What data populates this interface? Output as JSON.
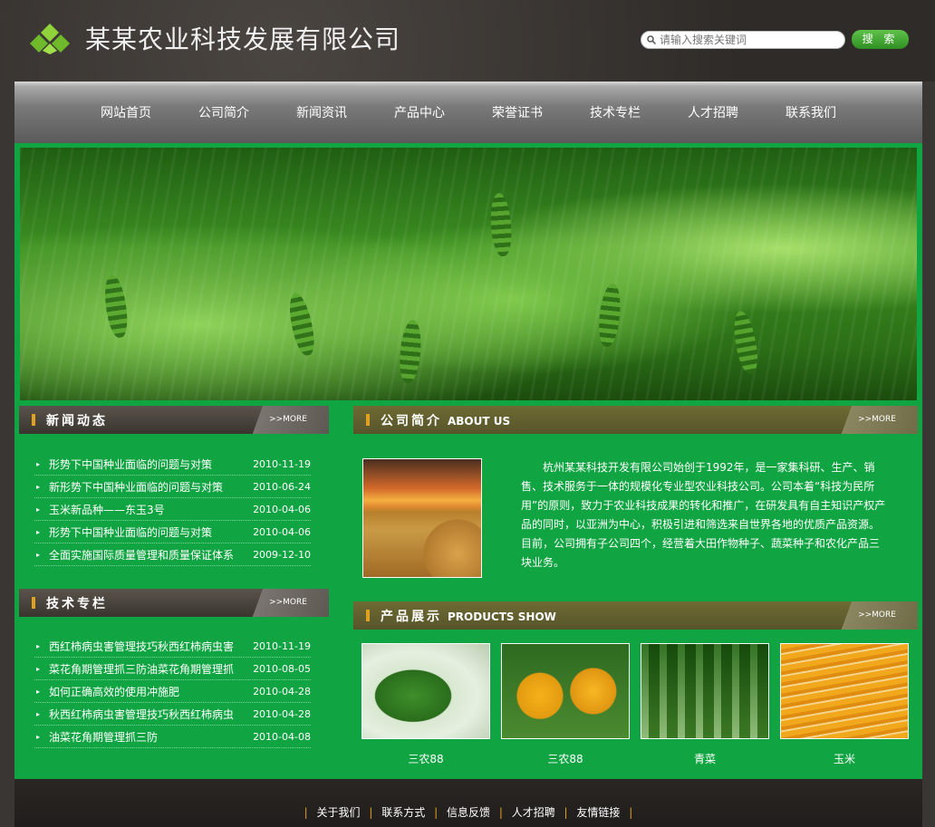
{
  "header": {
    "title": "某某农业科技发展有限公司",
    "search_placeholder": "请输入搜索关键词",
    "search_button": "搜 索"
  },
  "nav": [
    "网站首页",
    "公司简介",
    "新闻资讯",
    "产品中心",
    "荣誉证书",
    "技术专栏",
    "人才招聘",
    "联系我们"
  ],
  "news": {
    "title": "新闻动态",
    "more": ">>MORE",
    "items": [
      {
        "text": "形势下中国种业面临的问题与对策",
        "date": "2010-11-19"
      },
      {
        "text": "新形势下中国种业面临的问题与对策",
        "date": "2010-06-24"
      },
      {
        "text": "玉米新品种——东玉3号",
        "date": "2010-04-06"
      },
      {
        "text": "形势下中国种业面临的问题与对策",
        "date": "2010-04-06"
      },
      {
        "text": "全面实施国际质量管理和质量保证体系",
        "date": "2009-12-10"
      }
    ]
  },
  "tech": {
    "title": "技术专栏",
    "more": ">>MORE",
    "items": [
      {
        "text": "西红柿病虫害管理技巧秋西红柿病虫害",
        "date": "2010-11-19"
      },
      {
        "text": "菜花角期管理抓三防油菜花角期管理抓",
        "date": "2010-08-05"
      },
      {
        "text": "如何正确高效的使用冲施肥",
        "date": "2010-04-28"
      },
      {
        "text": "秋西红柿病虫害管理技巧秋西红柿病虫",
        "date": "2010-04-28"
      },
      {
        "text": "油菜花角期管理抓三防",
        "date": "2010-04-08"
      }
    ]
  },
  "about": {
    "title": "公司简介",
    "subtitle": "ABOUT US",
    "more": ">>MORE",
    "text": "杭州某某科技开发有限公司始创于1992年，是一家集科研、生产、销售、技术服务于一体的规模化专业型农业科技公司。公司本着“科技为民所用”的原则，致力于农业科技成果的转化和推广，在研发具有自主知识产权产品的同时，以亚洲为中心，积极引进和筛选来自世界各地的优质产品资源。目前，公司拥有子公司四个，经营着大田作物种子、蔬菜种子和农化产品三块业务。"
  },
  "products": {
    "title": "产品展示",
    "subtitle": "PRODUCTS SHOW",
    "more": ">>MORE",
    "items": [
      "三农88",
      "三农88",
      "青菜",
      "玉米"
    ]
  },
  "footer": [
    "关于我们",
    "联系方式",
    "信息反馈",
    "人才招聘",
    "友情链接"
  ]
}
